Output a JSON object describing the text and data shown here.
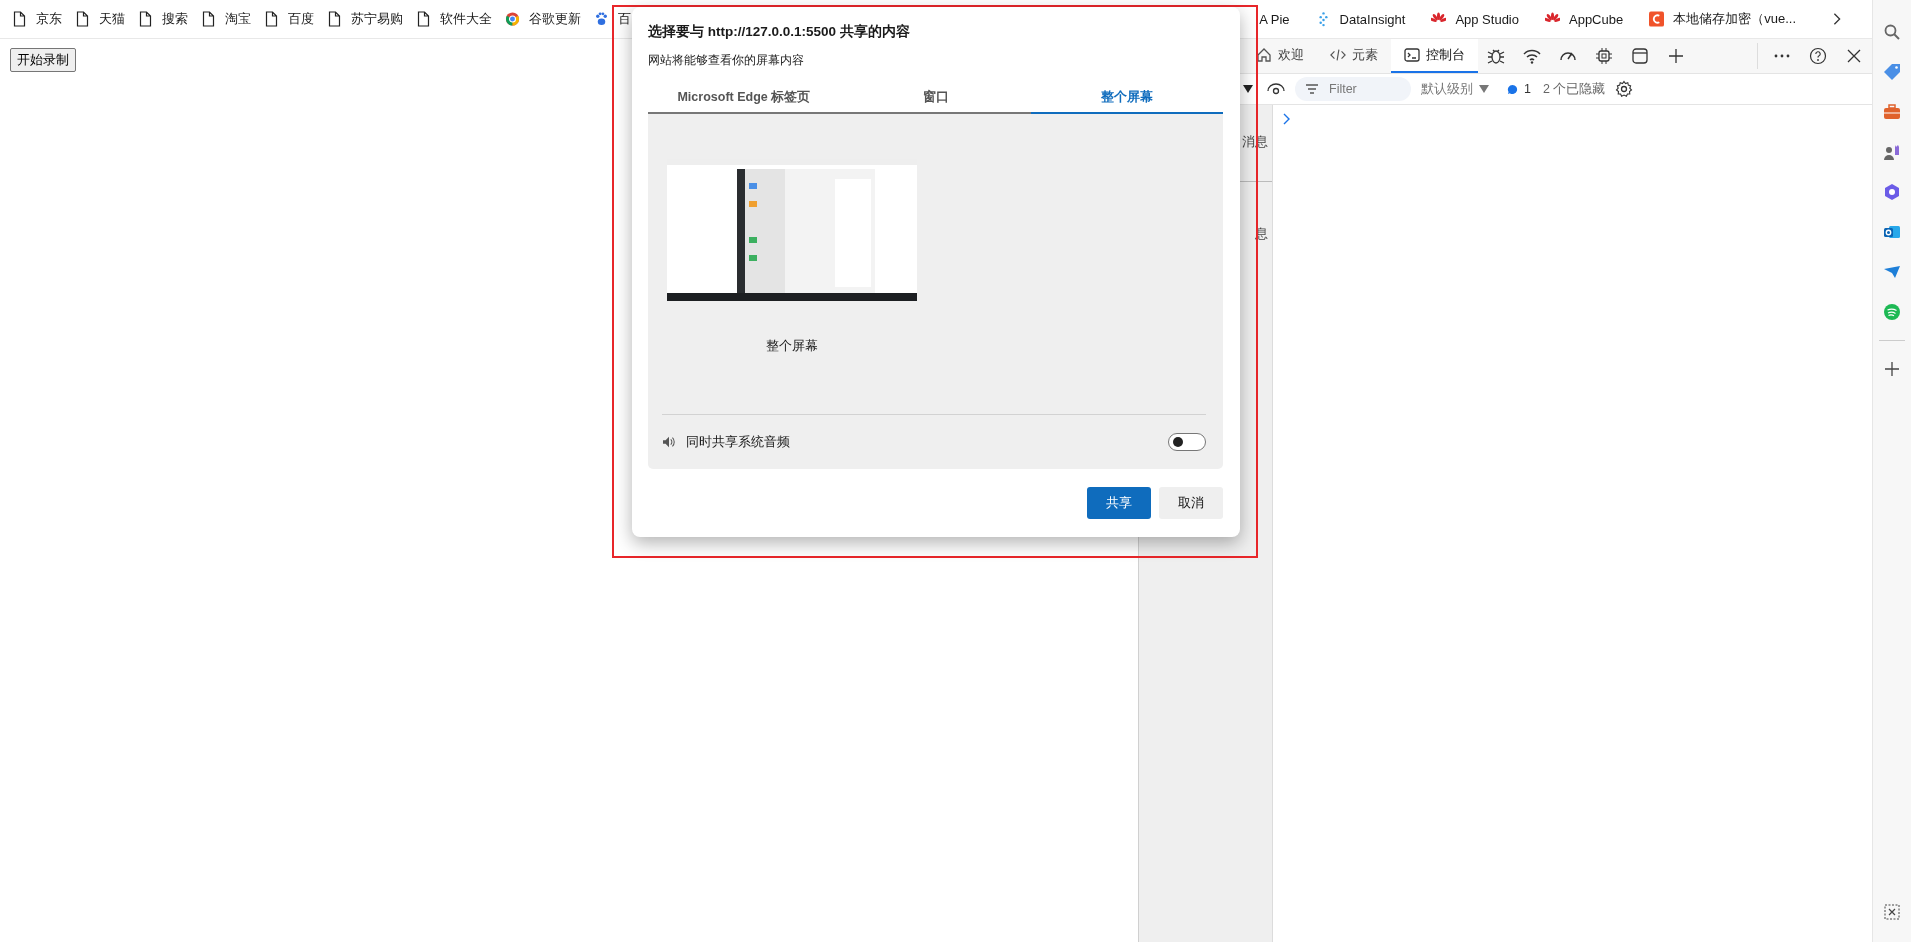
{
  "bookmarks_bar": {
    "items": [
      {
        "label": "京东",
        "kind": "page"
      },
      {
        "label": "天猫",
        "kind": "page"
      },
      {
        "label": "搜索",
        "kind": "page"
      },
      {
        "label": "淘宝",
        "kind": "page"
      },
      {
        "label": "百度",
        "kind": "page"
      },
      {
        "label": "苏宁易购",
        "kind": "page"
      },
      {
        "label": "软件大全",
        "kind": "page"
      },
      {
        "label": "谷歌更新",
        "kind": "chrome"
      },
      {
        "label": "百",
        "kind": "paw"
      }
    ],
    "right_items": [
      {
        "label": "A Pie",
        "kind": "none"
      },
      {
        "label": "DataInsight",
        "kind": "spark"
      },
      {
        "label": "App Studio",
        "kind": "flower"
      },
      {
        "label": "AppCube",
        "kind": "flower"
      },
      {
        "label": "本地储存加密（vue...",
        "kind": "letter"
      }
    ]
  },
  "page": {
    "record_button": "开始录制"
  },
  "dialog": {
    "title": "选择要与 http://127.0.0.1:5500 共享的内容",
    "subtitle": "网站将能够查看你的屏幕内容",
    "tabs": [
      {
        "label": "Microsoft Edge 标签页",
        "selected": false
      },
      {
        "label": "窗口",
        "selected": false
      },
      {
        "label": "整个屏幕",
        "selected": true
      }
    ],
    "source": {
      "label": "整个屏幕"
    },
    "audio": {
      "label": "同时共享系统音频",
      "on": false
    },
    "buttons": [
      {
        "label": "共享",
        "kind": "primary"
      },
      {
        "label": "取消",
        "kind": "secondary"
      }
    ]
  },
  "devtools": {
    "tabs": [
      {
        "label": "欢迎",
        "kind": "home",
        "selected": false
      },
      {
        "label": "元素",
        "kind": "code",
        "selected": false
      },
      {
        "label": "控制台",
        "kind": "console",
        "selected": true
      }
    ],
    "toolbar": {
      "filter_placeholder": "Filter",
      "level_menu": "默认级别",
      "message_count": "1",
      "hidden_count": "2 个已隐藏"
    },
    "sidebar_fragments": [
      "消息",
      "息"
    ]
  }
}
